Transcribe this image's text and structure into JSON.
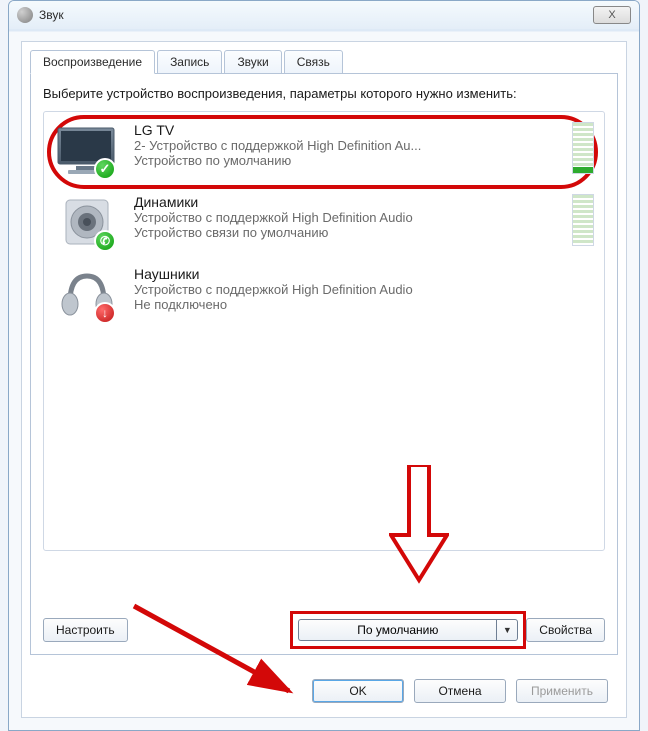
{
  "window": {
    "title": "Звук",
    "close": "X"
  },
  "tabs": {
    "playback": "Воспроизведение",
    "recording": "Запись",
    "sounds": "Звуки",
    "comm": "Связь"
  },
  "instruction": "Выберите устройство воспроизведения, параметры которого нужно изменить:",
  "devices": [
    {
      "name": "LG TV",
      "line1": "2- Устройство с поддержкой High Definition Au...",
      "line2": "Устройство по умолчанию"
    },
    {
      "name": "Динамики",
      "line1": "Устройство с поддержкой High Definition Audio",
      "line2": "Устройство связи по умолчанию"
    },
    {
      "name": "Наушники",
      "line1": "Устройство с поддержкой High Definition Audio",
      "line2": "Не подключено"
    }
  ],
  "buttons": {
    "configure": "Настроить",
    "set_default": "По умолчанию",
    "properties": "Свойства",
    "ok": "OK",
    "cancel": "Отмена",
    "apply": "Применить"
  }
}
